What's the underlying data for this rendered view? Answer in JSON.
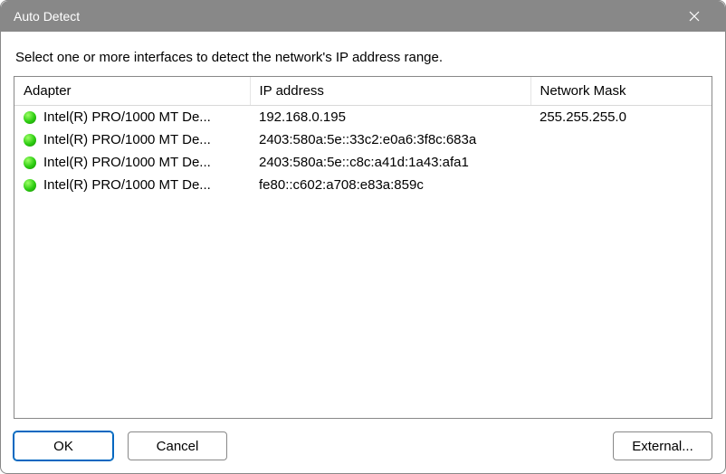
{
  "title": "Auto Detect",
  "instruction": "Select one or more interfaces to detect the network's IP address range.",
  "columns": {
    "adapter": "Adapter",
    "ip": "IP address",
    "mask": "Network Mask"
  },
  "rows": [
    {
      "status": "up",
      "adapter": "Intel(R) PRO/1000 MT De...",
      "ip": "192.168.0.195",
      "mask": "255.255.255.0"
    },
    {
      "status": "up",
      "adapter": "Intel(R) PRO/1000 MT De...",
      "ip": "2403:580a:5e::33c2:e0a6:3f8c:683a",
      "mask": ""
    },
    {
      "status": "up",
      "adapter": "Intel(R) PRO/1000 MT De...",
      "ip": "2403:580a:5e::c8c:a41d:1a43:afa1",
      "mask": ""
    },
    {
      "status": "up",
      "adapter": "Intel(R) PRO/1000 MT De...",
      "ip": "fe80::c602:a708:e83a:859c",
      "mask": ""
    }
  ],
  "buttons": {
    "ok": "OK",
    "cancel": "Cancel",
    "external": "External..."
  }
}
